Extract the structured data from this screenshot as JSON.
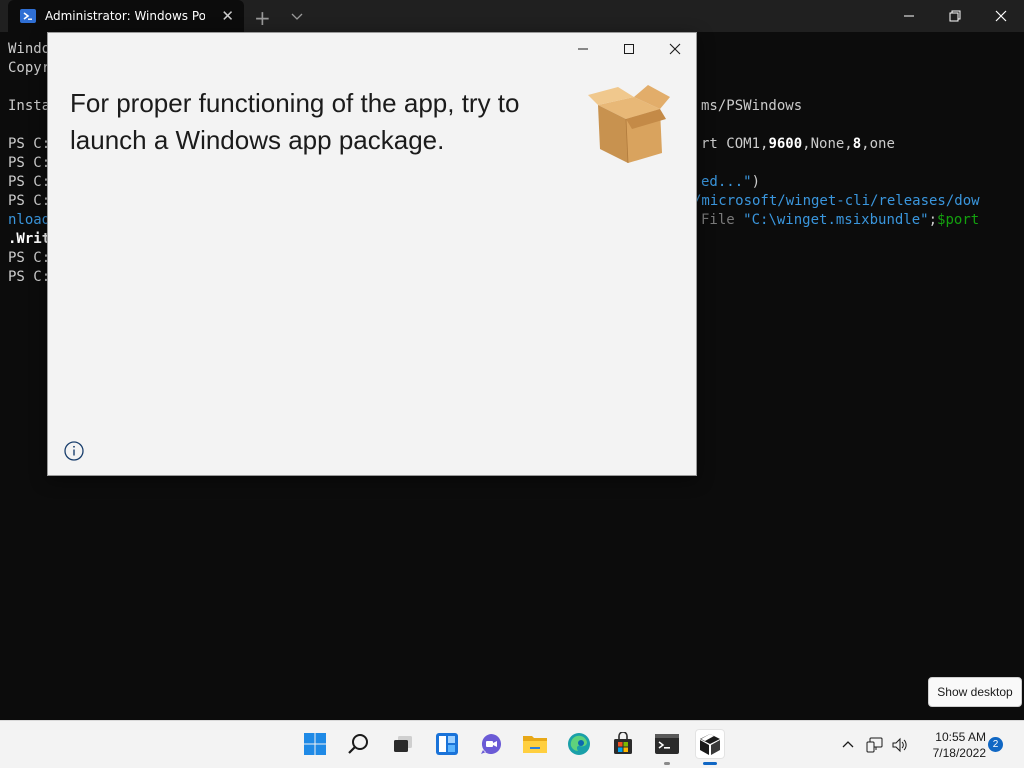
{
  "terminal": {
    "tab_title": "Administrator: Windows PowerS",
    "lines": [
      {
        "a": "Windo"
      },
      {
        "a": "Copyr"
      },
      {
        "a": ""
      },
      {
        "a": "Insta",
        "right": "ms/PSWindows"
      },
      {
        "a": ""
      },
      {
        "a": "PS C:",
        "r1": "rt COM1,",
        "r2": "9600",
        "r3": ",None,",
        "r4": "8",
        "r5": ",one"
      },
      {
        "a": "PS C:"
      },
      {
        "a": "PS C:",
        "rb": "ed...\"",
        "rw": ")"
      },
      {
        "a": "PS C:",
        "rb": "/microsoft/winget-cli/releases/dow"
      },
      {
        "ab": "nload",
        "rg1": "File ",
        "rb": "\"C:\\winget.msixbundle\"",
        "rw": ";",
        "rg": "$port"
      },
      {
        "aw": ".Writ"
      },
      {
        "a": "PS C:"
      },
      {
        "a": "PS C:"
      }
    ]
  },
  "dialog": {
    "message": "For proper functioning of the app, try to launch a Windows app package."
  },
  "taskbar": {
    "time": "10:55 AM",
    "date": "7/18/2022",
    "notification_count": "2",
    "show_desktop": "Show desktop"
  },
  "colors": {
    "terminal_bg": "#0c0c0c",
    "accent": "#1067c4",
    "dialog_bg": "#f3f3f3"
  }
}
